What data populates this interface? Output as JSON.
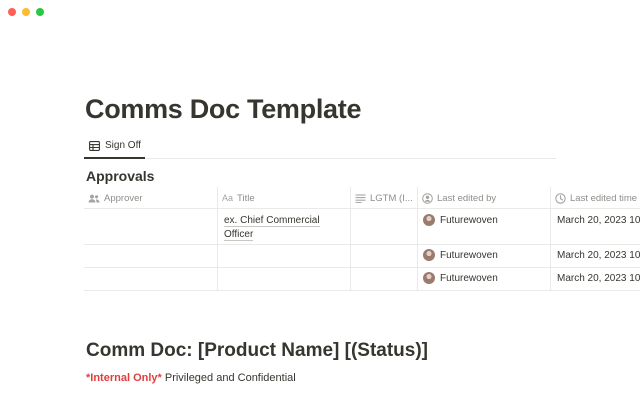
{
  "window": {
    "buttons": [
      "close",
      "minimize",
      "maximize"
    ]
  },
  "page": {
    "title": "Comms Doc Template"
  },
  "view_tabs": [
    {
      "label": "Sign Off",
      "icon": "table-icon",
      "active": true
    }
  ],
  "approvals": {
    "heading": "Approvals",
    "columns": [
      {
        "label": "Approver",
        "icon": "people-icon"
      },
      {
        "label": "Title",
        "icon": "text-aa-icon",
        "icon_text": "Aa"
      },
      {
        "label": "LGTM (I...",
        "icon": "list-icon"
      },
      {
        "label": "Last edited by",
        "icon": "person-circle-icon"
      },
      {
        "label": "Last edited time",
        "icon": "clock-icon"
      }
    ],
    "rows": [
      {
        "approver": "",
        "title": "ex. Chief Commercial Officer",
        "lgtm": "",
        "last_edited_by": "Futurewoven",
        "last_edited_time": "March 20, 2023 10:"
      },
      {
        "approver": "",
        "title": "",
        "lgtm": "",
        "last_edited_by": "Futurewoven",
        "last_edited_time": "March 20, 2023 10:"
      },
      {
        "approver": "",
        "title": "",
        "lgtm": "",
        "last_edited_by": "Futurewoven",
        "last_edited_time": "March 20, 2023 10:"
      }
    ]
  },
  "comm_doc": {
    "heading": "Comm Doc: [Product Name] [(Status)]",
    "internal_only": "*Internal Only*",
    "confidential": "Privileged and Confidential"
  },
  "colors": {
    "accent_red": "#e03e3e",
    "text": "#37352f",
    "muted": "#8f8e8a",
    "border": "#e9e9e7"
  }
}
